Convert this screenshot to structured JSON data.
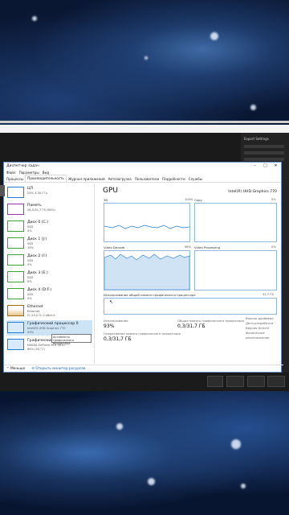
{
  "window": {
    "title": "Диспетчер задач",
    "minimize": "–",
    "maximize": "□",
    "close": "✕"
  },
  "menu": [
    "Файл",
    "Параметры",
    "Вид"
  ],
  "tabs": [
    "Процессы",
    "Производительность",
    "Журнал приложений",
    "Автозагрузка",
    "Пользователи",
    "Подробности",
    "Службы"
  ],
  "resources": [
    {
      "name": "ЦП",
      "sub": "23% 3,30 ГГц",
      "val": "",
      "color": "#1f7fd8"
    },
    {
      "name": "Память",
      "sub": "26,5/31,7 ГБ (84%)",
      "val": "",
      "color": "#9c36b5"
    },
    {
      "name": "Диск 0 (C:)",
      "sub": "SSD",
      "val": "0%",
      "color": "#3aa52f"
    },
    {
      "name": "Диск 1 (J:)",
      "sub": "SSD",
      "val": "19%",
      "color": "#3aa52f"
    },
    {
      "name": "Диск 2 (I:)",
      "sub": "SSD",
      "val": "0%",
      "color": "#3aa52f"
    },
    {
      "name": "Диск 3 (E:)",
      "sub": "SSD",
      "val": "0%",
      "color": "#3aa52f"
    },
    {
      "name": "Диск 4 (D:F:)",
      "sub": "SSD",
      "val": "0%",
      "color": "#3aa52f"
    },
    {
      "name": "Ethernet",
      "sub": "Ethernet",
      "val": "О: 24,0 П: 0 кбит/с",
      "color": "#a86a0f"
    },
    {
      "name": "Графический процессор 0",
      "sub": "Intel(R) UHD Graphics 770",
      "val": "93%",
      "color": "#1f7fd8"
    },
    {
      "name": "Графический процессор 1",
      "sub": "NVIDIA GeForce RTX 4070",
      "val": "84% (50 °C)",
      "color": "#1f7fd8"
    }
  ],
  "tooltip": "Активность графического процессора",
  "gpu": {
    "title": "GPU",
    "model": "Intel(R) UHD Graphics 770",
    "graphs": [
      {
        "label": "3D",
        "pct": "100%"
      },
      {
        "label": "Copy",
        "pct": "0%"
      },
      {
        "label": "Video Decode",
        "pct": "98%"
      },
      {
        "label": "Video Processing",
        "pct": "0%"
      }
    ],
    "shared_label": "Использование общей памяти графического процессора",
    "shared_max": "31,7 ГБ",
    "util_label": "Использование",
    "util_value": "93%",
    "mem_label": "Оперативная память графического процессора",
    "mem_value": "0,3/31,7 ГБ",
    "shared_mem_label": "Общая память графического процессора",
    "shared_mem_value": "0,3/31,7 ГБ",
    "props": [
      "Версия драйвера",
      "Дата разработки",
      "Версия DirectX",
      "Физическое расположение"
    ]
  },
  "bottom": {
    "less": "Меньше",
    "monitor": "Открыть монитор ресурсов"
  },
  "side_panel": {
    "title": "Export Settings"
  }
}
